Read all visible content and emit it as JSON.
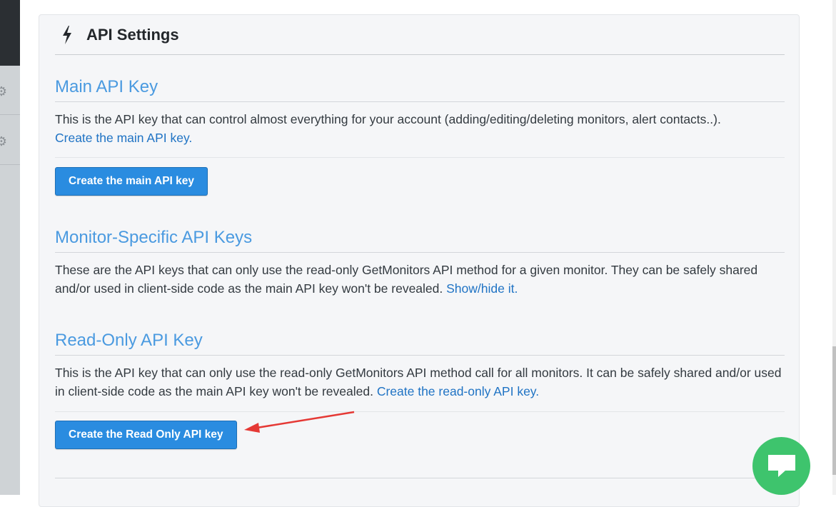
{
  "panel": {
    "title": "API Settings",
    "icon": "bolt-icon"
  },
  "sections": {
    "main": {
      "heading": "Main API Key",
      "text": "This is the API key that can control almost everything for your account (adding/editing/deleting monitors, alert contacts..).",
      "link": "Create the main API key.",
      "button": "Create the main API key"
    },
    "monitor": {
      "heading": "Monitor-Specific API Keys",
      "text": "These are the API keys that can only use the read-only GetMonitors API method for a given monitor. They can be safely shared and/or used in client-side code as the main API key won't be revealed.",
      "link": "Show/hide it."
    },
    "readonly": {
      "heading": "Read-Only API Key",
      "text": "This is the API key that can only use the read-only GetMonitors API method call for all monitors. It can be safely shared and/or used in client-side code as the main API key won't be revealed.",
      "link": "Create the read-only API key.",
      "button": "Create the Read Only API key"
    }
  },
  "colors": {
    "accent": "#2a8ce0",
    "heading": "#4a9ae0",
    "link": "#1f73c4",
    "chat": "#3ec46d",
    "annotation": "#e53935"
  },
  "icons": [
    "gear-icon",
    "bolt-icon",
    "chat-icon",
    "arrow-annotation"
  ]
}
